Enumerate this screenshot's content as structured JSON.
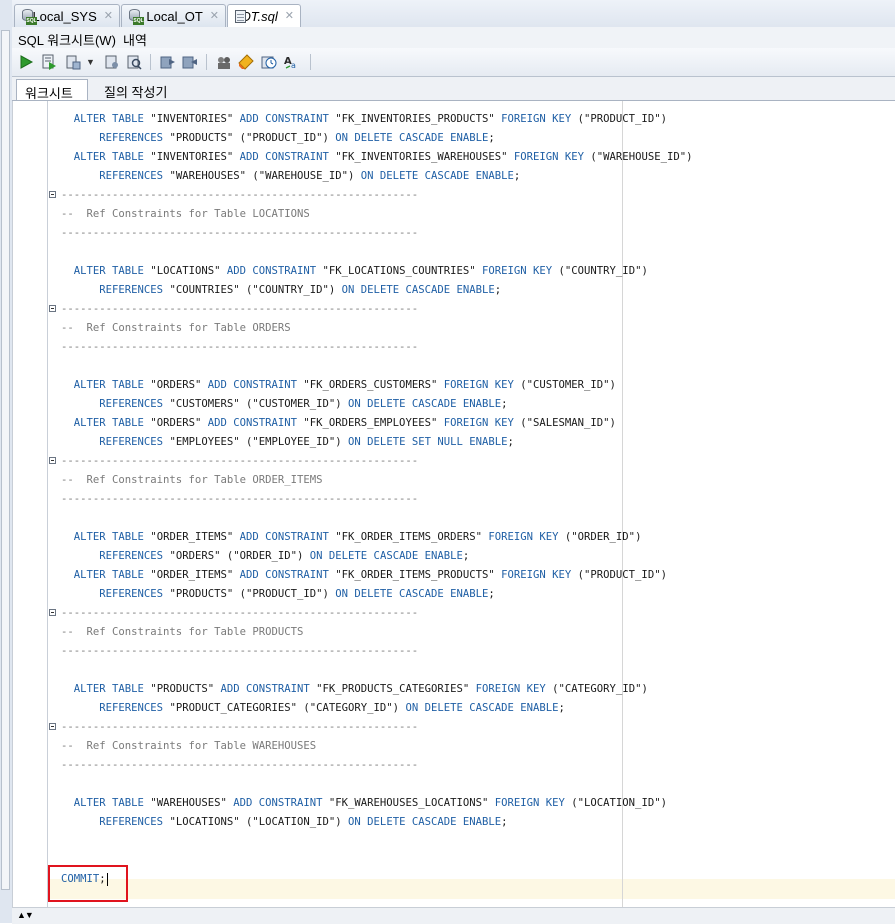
{
  "tabs": [
    {
      "label": "Local_SYS",
      "icon": "database-sql-icon"
    },
    {
      "label": "Local_OT",
      "icon": "database-sql-icon"
    },
    {
      "label": "OT.sql",
      "icon": "sql-file-icon"
    }
  ],
  "subtabs": {
    "worksheet": "SQL 워크시트(W)",
    "history": "내역"
  },
  "toolbar": {
    "run_statement": "run-statement",
    "run_script": "run-script",
    "explain_plan": "explain-plan",
    "autotrace": "autotrace",
    "commit": "commit",
    "rollback": "rollback",
    "sql_tuning": "sql-tuning-advisor",
    "clear": "clear",
    "sql_history": "sql-history",
    "format": "format"
  },
  "worksheet_tabs": {
    "worksheet": "워크시트",
    "query_builder": "질의 작성기"
  },
  "editor": {
    "lines": [
      {
        "indent": "  ",
        "parts": [
          [
            "kw",
            "ALTER TABLE "
          ],
          [
            "str",
            "\"INVENTORIES\" "
          ],
          [
            "kw",
            "ADD CONSTRAINT "
          ],
          [
            "str",
            "\"FK_INVENTORIES_PRODUCTS\" "
          ],
          [
            "kw",
            "FOREIGN KEY "
          ],
          [
            "str",
            "(\"PRODUCT_ID\")"
          ]
        ]
      },
      {
        "indent": "      ",
        "parts": [
          [
            "kw",
            "REFERENCES "
          ],
          [
            "str",
            "\"PRODUCTS\" (\"PRODUCT_ID\") "
          ],
          [
            "kw",
            "ON DELETE CASCADE ENABLE"
          ],
          [
            "plain",
            ";"
          ]
        ]
      },
      {
        "indent": "  ",
        "parts": [
          [
            "kw",
            "ALTER TABLE "
          ],
          [
            "str",
            "\"INVENTORIES\" "
          ],
          [
            "kw",
            "ADD CONSTRAINT "
          ],
          [
            "str",
            "\"FK_INVENTORIES_WAREHOUSES\" "
          ],
          [
            "kw",
            "FOREIGN KEY "
          ],
          [
            "str",
            "(\"WAREHOUSE_ID\")"
          ]
        ]
      },
      {
        "indent": "      ",
        "parts": [
          [
            "kw",
            "REFERENCES "
          ],
          [
            "str",
            "\"WAREHOUSES\" (\"WAREHOUSE_ID\") "
          ],
          [
            "kw",
            "ON DELETE CASCADE ENABLE"
          ],
          [
            "plain",
            ";"
          ]
        ]
      },
      {
        "indent": "",
        "parts": [
          [
            "cmt",
            "--------------------------------------------------------"
          ]
        ],
        "fold": true
      },
      {
        "indent": "",
        "parts": [
          [
            "cmt",
            "--  Ref Constraints for Table LOCATIONS"
          ]
        ]
      },
      {
        "indent": "",
        "parts": [
          [
            "cmt",
            "--------------------------------------------------------"
          ]
        ]
      },
      {
        "indent": "",
        "parts": []
      },
      {
        "indent": "  ",
        "parts": [
          [
            "kw",
            "ALTER TABLE "
          ],
          [
            "str",
            "\"LOCATIONS\" "
          ],
          [
            "kw",
            "ADD CONSTRAINT "
          ],
          [
            "str",
            "\"FK_LOCATIONS_COUNTRIES\" "
          ],
          [
            "kw",
            "FOREIGN KEY "
          ],
          [
            "str",
            "(\"COUNTRY_ID\")"
          ]
        ]
      },
      {
        "indent": "      ",
        "parts": [
          [
            "kw",
            "REFERENCES "
          ],
          [
            "str",
            "\"COUNTRIES\" (\"COUNTRY_ID\") "
          ],
          [
            "kw",
            "ON DELETE CASCADE ENABLE"
          ],
          [
            "plain",
            ";"
          ]
        ]
      },
      {
        "indent": "",
        "parts": [
          [
            "cmt",
            "--------------------------------------------------------"
          ]
        ],
        "fold": true
      },
      {
        "indent": "",
        "parts": [
          [
            "cmt",
            "--  Ref Constraints for Table ORDERS"
          ]
        ]
      },
      {
        "indent": "",
        "parts": [
          [
            "cmt",
            "--------------------------------------------------------"
          ]
        ]
      },
      {
        "indent": "",
        "parts": []
      },
      {
        "indent": "  ",
        "parts": [
          [
            "kw",
            "ALTER TABLE "
          ],
          [
            "str",
            "\"ORDERS\" "
          ],
          [
            "kw",
            "ADD CONSTRAINT "
          ],
          [
            "str",
            "\"FK_ORDERS_CUSTOMERS\" "
          ],
          [
            "kw",
            "FOREIGN KEY "
          ],
          [
            "str",
            "(\"CUSTOMER_ID\")"
          ]
        ]
      },
      {
        "indent": "      ",
        "parts": [
          [
            "kw",
            "REFERENCES "
          ],
          [
            "str",
            "\"CUSTOMERS\" (\"CUSTOMER_ID\") "
          ],
          [
            "kw",
            "ON DELETE CASCADE ENABLE"
          ],
          [
            "plain",
            ";"
          ]
        ]
      },
      {
        "indent": "  ",
        "parts": [
          [
            "kw",
            "ALTER TABLE "
          ],
          [
            "str",
            "\"ORDERS\" "
          ],
          [
            "kw",
            "ADD CONSTRAINT "
          ],
          [
            "str",
            "\"FK_ORDERS_EMPLOYEES\" "
          ],
          [
            "kw",
            "FOREIGN KEY "
          ],
          [
            "str",
            "(\"SALESMAN_ID\")"
          ]
        ]
      },
      {
        "indent": "      ",
        "parts": [
          [
            "kw",
            "REFERENCES "
          ],
          [
            "str",
            "\"EMPLOYEES\" (\"EMPLOYEE_ID\") "
          ],
          [
            "kw",
            "ON DELETE SET NULL ENABLE"
          ],
          [
            "plain",
            ";"
          ]
        ]
      },
      {
        "indent": "",
        "parts": [
          [
            "cmt",
            "--------------------------------------------------------"
          ]
        ],
        "fold": true
      },
      {
        "indent": "",
        "parts": [
          [
            "cmt",
            "--  Ref Constraints for Table ORDER_ITEMS"
          ]
        ]
      },
      {
        "indent": "",
        "parts": [
          [
            "cmt",
            "--------------------------------------------------------"
          ]
        ]
      },
      {
        "indent": "",
        "parts": []
      },
      {
        "indent": "  ",
        "parts": [
          [
            "kw",
            "ALTER TABLE "
          ],
          [
            "str",
            "\"ORDER_ITEMS\" "
          ],
          [
            "kw",
            "ADD CONSTRAINT "
          ],
          [
            "str",
            "\"FK_ORDER_ITEMS_ORDERS\" "
          ],
          [
            "kw",
            "FOREIGN KEY "
          ],
          [
            "str",
            "(\"ORDER_ID\")"
          ]
        ]
      },
      {
        "indent": "      ",
        "parts": [
          [
            "kw",
            "REFERENCES "
          ],
          [
            "str",
            "\"ORDERS\" (\"ORDER_ID\") "
          ],
          [
            "kw",
            "ON DELETE CASCADE ENABLE"
          ],
          [
            "plain",
            ";"
          ]
        ]
      },
      {
        "indent": "  ",
        "parts": [
          [
            "kw",
            "ALTER TABLE "
          ],
          [
            "str",
            "\"ORDER_ITEMS\" "
          ],
          [
            "kw",
            "ADD CONSTRAINT "
          ],
          [
            "str",
            "\"FK_ORDER_ITEMS_PRODUCTS\" "
          ],
          [
            "kw",
            "FOREIGN KEY "
          ],
          [
            "str",
            "(\"PRODUCT_ID\")"
          ]
        ]
      },
      {
        "indent": "      ",
        "parts": [
          [
            "kw",
            "REFERENCES "
          ],
          [
            "str",
            "\"PRODUCTS\" (\"PRODUCT_ID\") "
          ],
          [
            "kw",
            "ON DELETE CASCADE ENABLE"
          ],
          [
            "plain",
            ";"
          ]
        ]
      },
      {
        "indent": "",
        "parts": [
          [
            "cmt",
            "--------------------------------------------------------"
          ]
        ],
        "fold": true
      },
      {
        "indent": "",
        "parts": [
          [
            "cmt",
            "--  Ref Constraints for Table PRODUCTS"
          ]
        ]
      },
      {
        "indent": "",
        "parts": [
          [
            "cmt",
            "--------------------------------------------------------"
          ]
        ]
      },
      {
        "indent": "",
        "parts": []
      },
      {
        "indent": "  ",
        "parts": [
          [
            "kw",
            "ALTER TABLE "
          ],
          [
            "str",
            "\"PRODUCTS\" "
          ],
          [
            "kw",
            "ADD CONSTRAINT "
          ],
          [
            "str",
            "\"FK_PRODUCTS_CATEGORIES\" "
          ],
          [
            "kw",
            "FOREIGN KEY "
          ],
          [
            "str",
            "(\"CATEGORY_ID\")"
          ]
        ]
      },
      {
        "indent": "      ",
        "parts": [
          [
            "kw",
            "REFERENCES "
          ],
          [
            "str",
            "\"PRODUCT_CATEGORIES\" (\"CATEGORY_ID\") "
          ],
          [
            "kw",
            "ON DELETE CASCADE ENABLE"
          ],
          [
            "plain",
            ";"
          ]
        ]
      },
      {
        "indent": "",
        "parts": [
          [
            "cmt",
            "--------------------------------------------------------"
          ]
        ],
        "fold": true
      },
      {
        "indent": "",
        "parts": [
          [
            "cmt",
            "--  Ref Constraints for Table WAREHOUSES"
          ]
        ]
      },
      {
        "indent": "",
        "parts": [
          [
            "cmt",
            "--------------------------------------------------------"
          ]
        ]
      },
      {
        "indent": "",
        "parts": []
      },
      {
        "indent": "  ",
        "parts": [
          [
            "kw",
            "ALTER TABLE "
          ],
          [
            "str",
            "\"WAREHOUSES\" "
          ],
          [
            "kw",
            "ADD CONSTRAINT "
          ],
          [
            "str",
            "\"FK_WAREHOUSES_LOCATIONS\" "
          ],
          [
            "kw",
            "FOREIGN KEY "
          ],
          [
            "str",
            "(\"LOCATION_ID\")"
          ]
        ]
      },
      {
        "indent": "      ",
        "parts": [
          [
            "kw",
            "REFERENCES "
          ],
          [
            "str",
            "\"LOCATIONS\" (\"LOCATION_ID\") "
          ],
          [
            "kw",
            "ON DELETE CASCADE ENABLE"
          ],
          [
            "plain",
            ";"
          ]
        ]
      },
      {
        "indent": "",
        "parts": []
      },
      {
        "indent": "",
        "parts": []
      },
      {
        "indent": "",
        "parts": [
          [
            "kw",
            "COMMIT"
          ],
          [
            "plain",
            ";"
          ]
        ],
        "caret": true
      }
    ]
  }
}
